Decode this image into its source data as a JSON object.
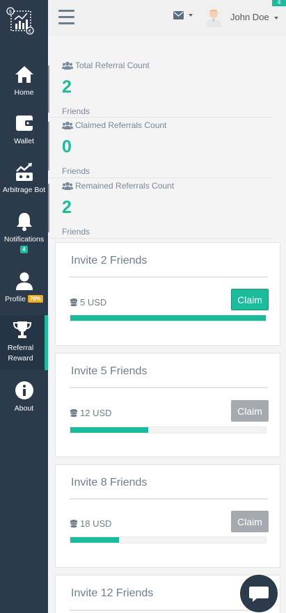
{
  "nav": [
    {
      "label": "Home",
      "icon": "home-icon"
    },
    {
      "label": "Wallet",
      "icon": "wallet-icon"
    },
    {
      "label": "Arbitrage Bot",
      "icon": "robot-chart-icon"
    },
    {
      "label": "Notifications",
      "icon": "bell-icon",
      "badge": "4"
    },
    {
      "label": "Profile",
      "icon": "user-icon",
      "badge": "70%"
    },
    {
      "label": "Referral Reward",
      "icon": "trophy-icon"
    },
    {
      "label": "About",
      "icon": "info-icon"
    }
  ],
  "topbar": {
    "badge": "4",
    "user_name": "John Doe"
  },
  "stats": [
    {
      "title": "Total Referral Count",
      "value": "2",
      "unit": "Friends"
    },
    {
      "title": "Claimed Referrals Count",
      "value": "0",
      "unit": "Friends"
    },
    {
      "title": "Remained Referrals Count",
      "value": "2",
      "unit": "Friends"
    }
  ],
  "cards": [
    {
      "title": "Invite 2 Friends",
      "reward": "5 USD",
      "claim_label": "Claim",
      "claim_enabled": true,
      "progress": 1.0
    },
    {
      "title": "Invite 5 Friends",
      "reward": "12 USD",
      "claim_label": "Claim",
      "claim_enabled": false,
      "progress": 0.4
    },
    {
      "title": "Invite 8 Friends",
      "reward": "18 USD",
      "claim_label": "Claim",
      "claim_enabled": false,
      "progress": 0.25
    },
    {
      "title": "Invite 12 Friends"
    }
  ],
  "colors": {
    "sidebar": "#2c3b4b",
    "accent": "#1bbc9b",
    "profile_badge": "#f0ad1a",
    "disabled_button": "#a5aab0"
  }
}
